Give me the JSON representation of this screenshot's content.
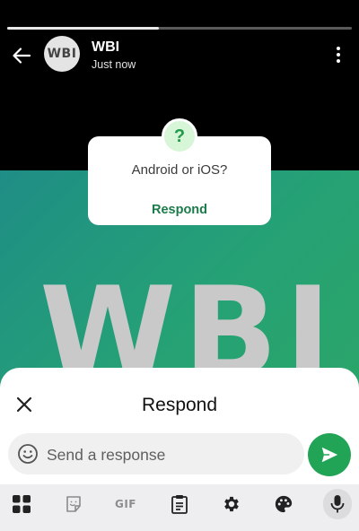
{
  "header": {
    "avatar_text": "WBI",
    "sender_name": "WBI",
    "timestamp": "Just now",
    "progress_fraction": 0.44
  },
  "status": {
    "background_text": "WBI",
    "sticker": {
      "badge_symbol": "?",
      "question": "Android or iOS?",
      "action_label": "Respond"
    }
  },
  "sheet": {
    "title": "Respond",
    "input_placeholder": "Send a response",
    "input_value": ""
  },
  "keyboard_toolbar": {
    "items": [
      "apps-grid-icon",
      "sticker-icon",
      "GIF",
      "clipboard-icon",
      "settings-gear-icon",
      "palette-icon",
      "microphone-icon"
    ]
  },
  "colors": {
    "accent": "#21a455",
    "respond_text": "#1b7b4a",
    "status_gradient_start": "#1f8d86",
    "status_gradient_end": "#2ea862"
  }
}
